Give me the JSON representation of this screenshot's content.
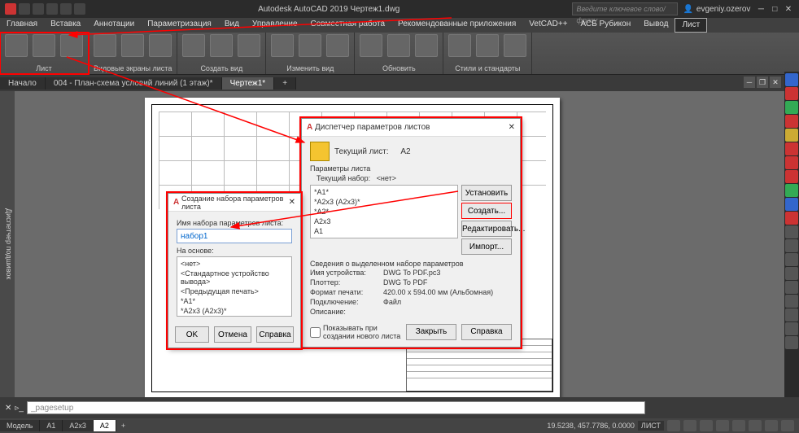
{
  "app": {
    "title": "Autodesk AutoCAD 2019   Чертеж1.dwg",
    "search_placeholder": "Введите ключевое слово/фразу",
    "user": "evgeniy.ozerov"
  },
  "menu": [
    "Главная",
    "Вставка",
    "Аннотации",
    "Параметризация",
    "Вид",
    "Управление",
    "Совместная работа",
    "Рекомендованные приложения",
    "VetCAD++",
    "АСБ Рубикон",
    "Вывод",
    "Лист"
  ],
  "ribbon_panels": [
    {
      "label": "Лист",
      "hl": true
    },
    {
      "label": "Видовые экраны листа"
    },
    {
      "label": "Создать вид"
    },
    {
      "label": "Изменить вид"
    },
    {
      "label": "Обновить"
    },
    {
      "label": "Стили и стандарты"
    }
  ],
  "file_tabs": [
    {
      "label": "Начало",
      "active": false
    },
    {
      "label": "004 - План-схема условий линий (1 этаж)*",
      "active": false
    },
    {
      "label": "Чертеж1*",
      "active": true
    }
  ],
  "side_label": "Диспетчер подшивок",
  "dlg1": {
    "title": "Диспетчер параметров листов",
    "current_prefix": "Текущий лист:",
    "current_sheet": "A2",
    "params_caption": "Параметры листа",
    "set_prefix": "Текущий набор:",
    "set_value": "<нет>",
    "list": [
      "*A1*",
      "*A2x3 (A2x3)*",
      "*A2*",
      "A2x3",
      "A1"
    ],
    "btn_set": "Установить",
    "btn_new": "Создать...",
    "btn_edit": "Редактировать...",
    "btn_import": "Импорт...",
    "info_caption": "Сведения о выделенном наборе параметров",
    "info": {
      "Имя устройства:": "DWG To PDF.pc3",
      "Плоттер:": "DWG To PDF",
      "Формат печати:": "420.00 x 594.00 мм (Альбомная)",
      "Подключение:": "Файл",
      "Описание:": ""
    },
    "chk": "Показывать при создании нового листа",
    "btn_close": "Закрыть",
    "btn_help": "Справка"
  },
  "dlg2": {
    "title": "Создание набора параметров листа",
    "lbl1": "Имя набора параметров листа:",
    "name_value": "набор1",
    "lbl2": "На основе:",
    "based_list": [
      "<нет>",
      "<Стандартное устройство вывода>",
      "<Предыдущая печать>",
      "*A1*",
      "*A2x3 (A2x3)*"
    ],
    "btn_ok": "OK",
    "btn_cancel": "Отмена",
    "btn_help": "Справка"
  },
  "cmd": "_pagesetup",
  "model_tabs": [
    "Модель",
    "A1",
    "A2x3",
    "A2"
  ],
  "status": {
    "coords": "19.5238, 457.7786, 0.0000",
    "mode": "ЛИСТ"
  }
}
